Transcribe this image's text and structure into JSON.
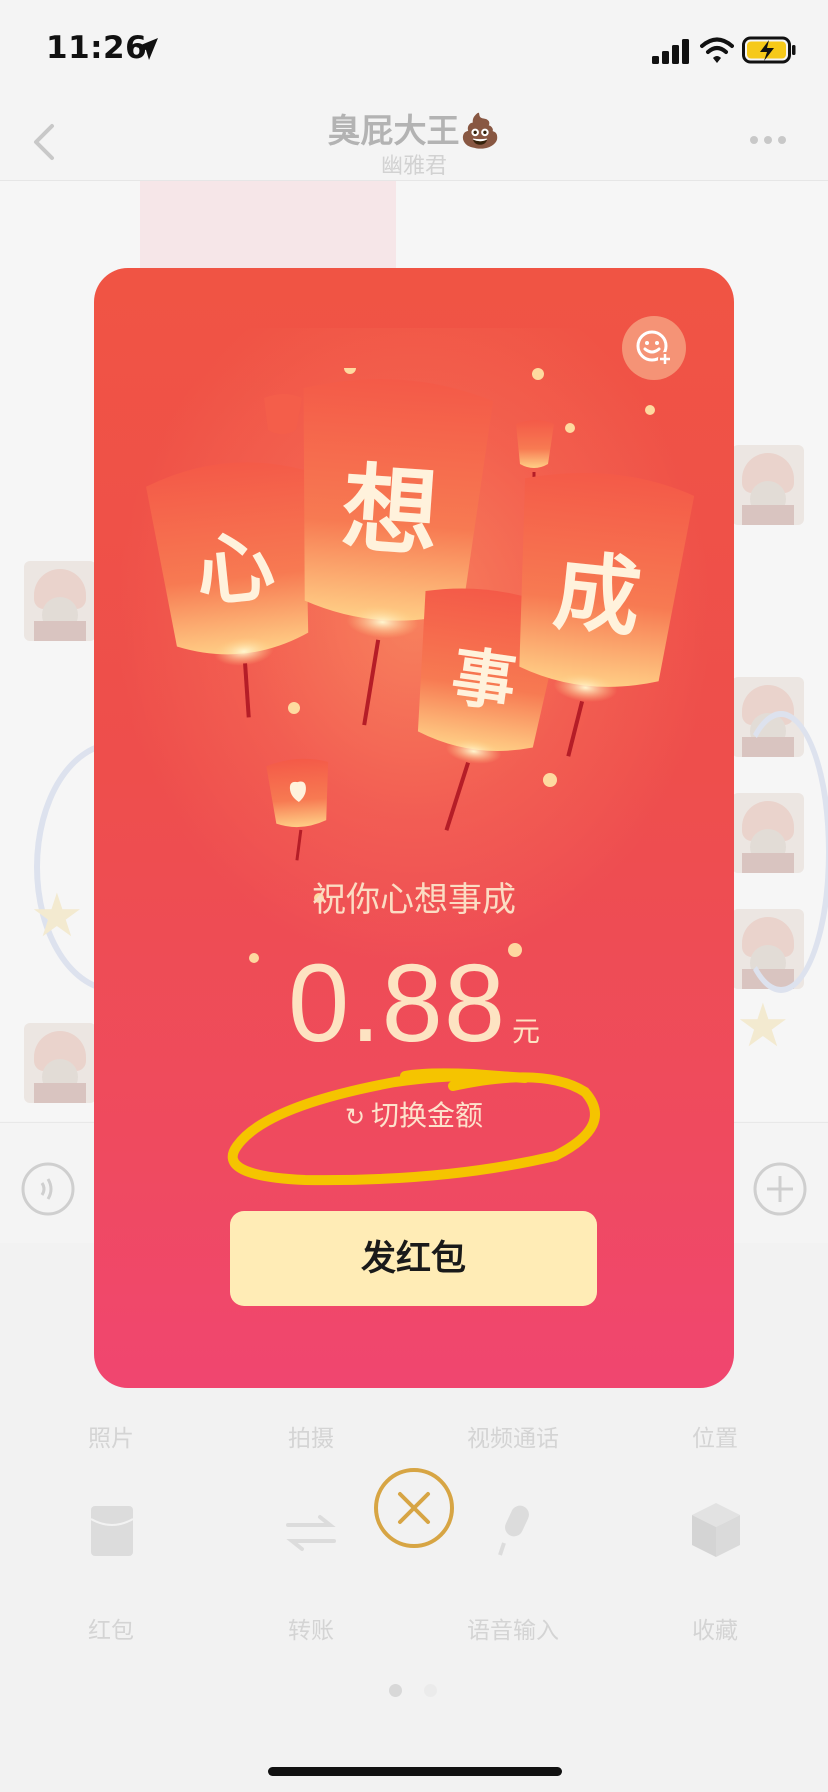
{
  "status_bar": {
    "time": "11:26"
  },
  "header": {
    "title": "臭屁大王💩",
    "subtitle": "幽雅君"
  },
  "envelope": {
    "lantern_chars": [
      "心",
      "想",
      "事",
      "成"
    ],
    "blessing": "祝你心想事成",
    "amount": "0.88",
    "unit": "元",
    "switch_label": "切换金额",
    "send_label": "发红包"
  },
  "panel": {
    "row1": [
      "照片",
      "拍摄",
      "视频通话",
      "位置"
    ],
    "row2": [
      "红包",
      "转账",
      "语音输入",
      "收藏"
    ]
  },
  "colors": {
    "card_top": "#f05444",
    "card_bottom": "#f04670",
    "send_button": "#ffecb6",
    "gold_text": "#fde3c2",
    "scribble": "#f5c400",
    "close_ring": "#d7a544"
  }
}
